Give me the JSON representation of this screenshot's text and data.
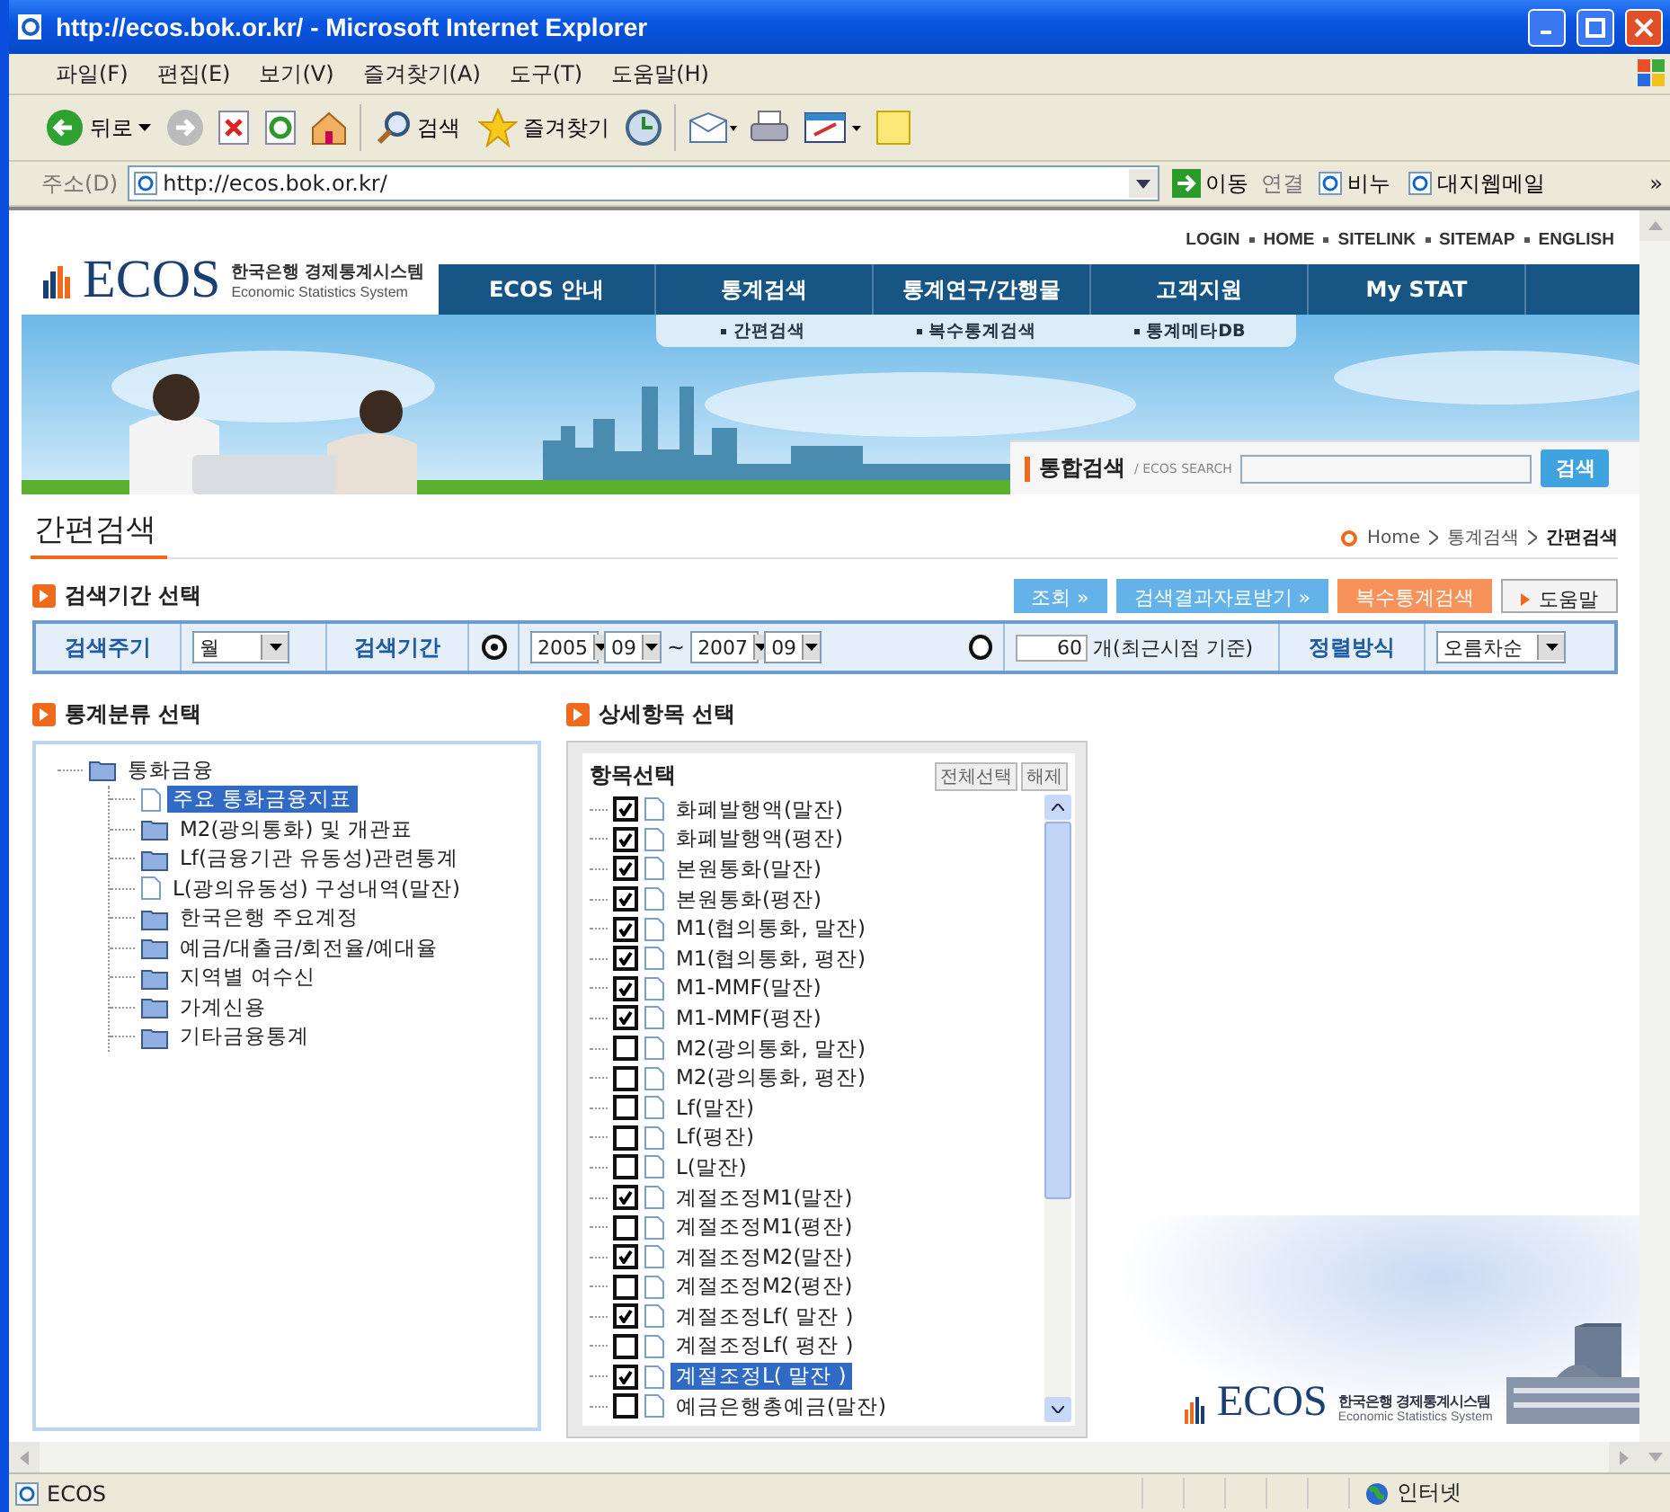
{
  "window": {
    "title": "http://ecos.bok.or.kr/ - Microsoft Internet Explorer"
  },
  "menu": [
    "파일(F)",
    "편집(E)",
    "보기(V)",
    "즐겨찾기(A)",
    "도구(T)",
    "도움말(H)"
  ],
  "toolbar": {
    "back": "뒤로",
    "search": "검색",
    "favorites": "즐겨찾기"
  },
  "address": {
    "label": "주소(D)",
    "url": "http://ecos.bok.or.kr/",
    "go": "이동",
    "links_label": "연결",
    "links": [
      "비누",
      "대지웹메일"
    ],
    "more": "»"
  },
  "site": {
    "top_links": [
      "LOGIN",
      "HOME",
      "SITELINK",
      "SITEMAP",
      "ENGLISH"
    ],
    "logo": {
      "name": "ECOS",
      "korean": "한국은행 경제통계시스템",
      "english": "Economic Statistics System"
    },
    "nav": [
      "ECOS 안내",
      "통계검색",
      "통계연구/간행물",
      "고객지원",
      "My STAT"
    ],
    "subnav": [
      "간편검색",
      "복수통계검색",
      "통계메타DB"
    ],
    "unified_search": {
      "title": "통합검색",
      "subtitle": "/ ECOS SEARCH",
      "button": "검색"
    }
  },
  "page": {
    "title": "간편검색",
    "breadcrumb": [
      "Home",
      "통계검색",
      "간편검색"
    ]
  },
  "period": {
    "title": "검색기간 선택",
    "buttons": [
      {
        "label": "조회 »",
        "kind": "blue"
      },
      {
        "label": "검색결과자료받기 »",
        "kind": "blue"
      },
      {
        "label": "복수통계검색",
        "kind": "orange"
      },
      {
        "label": "도움말",
        "kind": "plain"
      }
    ]
  },
  "filter": {
    "cycle_label": "검색주기",
    "cycle_value": "월",
    "period_label": "검색기간",
    "range": {
      "selected": true,
      "from_year": "2005",
      "from_month": "09",
      "separator": "~",
      "to_year": "2007",
      "to_month": "09"
    },
    "recent": {
      "selected": false,
      "count": "60",
      "suffix": "개(최근시점 기준)"
    },
    "sort_label": "정렬방식",
    "sort_value": "오름차순"
  },
  "tree": {
    "title": "통계분류 선택",
    "root": {
      "label": "통화금융",
      "kind": "folder",
      "selected": false,
      "children": [
        {
          "label": "주요 통화금융지표",
          "kind": "file",
          "selected": true
        },
        {
          "label": "M2(광의통화) 및 개관표",
          "kind": "folder",
          "selected": false
        },
        {
          "label": "Lf(금융기관 유동성)관련통계",
          "kind": "folder",
          "selected": false
        },
        {
          "label": "L(광의유동성) 구성내역(말잔)",
          "kind": "file",
          "selected": false
        },
        {
          "label": "한국은행 주요계정",
          "kind": "folder",
          "selected": false
        },
        {
          "label": "예금/대출금/회전율/예대율",
          "kind": "folder",
          "selected": false
        },
        {
          "label": "지역별 여수신",
          "kind": "folder",
          "selected": false
        },
        {
          "label": "가계신용",
          "kind": "folder",
          "selected": false
        },
        {
          "label": "기타금융통계",
          "kind": "folder",
          "selected": false
        }
      ]
    }
  },
  "items": {
    "title": "상세항목 선택",
    "header": "항목선택",
    "buttons": [
      "전체선택",
      "해제"
    ],
    "list": [
      {
        "label": "화폐발행액(말잔)",
        "checked": true,
        "selected": false
      },
      {
        "label": "화폐발행액(평잔)",
        "checked": true,
        "selected": false
      },
      {
        "label": "본원통화(말잔)",
        "checked": true,
        "selected": false
      },
      {
        "label": "본원통화(평잔)",
        "checked": true,
        "selected": false
      },
      {
        "label": "M1(협의통화, 말잔)",
        "checked": true,
        "selected": false
      },
      {
        "label": "M1(협의통화, 평잔)",
        "checked": true,
        "selected": false
      },
      {
        "label": "M1-MMF(말잔)",
        "checked": true,
        "selected": false
      },
      {
        "label": "M1-MMF(평잔)",
        "checked": true,
        "selected": false
      },
      {
        "label": "M2(광의통화, 말잔)",
        "checked": false,
        "selected": false
      },
      {
        "label": "M2(광의통화, 평잔)",
        "checked": false,
        "selected": false
      },
      {
        "label": "Lf(말잔)",
        "checked": false,
        "selected": false
      },
      {
        "label": "Lf(평잔)",
        "checked": false,
        "selected": false
      },
      {
        "label": "L(말잔)",
        "checked": false,
        "selected": false
      },
      {
        "label": "계절조정M1(말잔)",
        "checked": true,
        "selected": false
      },
      {
        "label": "계절조정M1(평잔)",
        "checked": false,
        "selected": false
      },
      {
        "label": "계절조정M2(말잔)",
        "checked": true,
        "selected": false
      },
      {
        "label": "계절조정M2(평잔)",
        "checked": false,
        "selected": false
      },
      {
        "label": "계절조정Lf( 말잔 )",
        "checked": true,
        "selected": false
      },
      {
        "label": "계절조정Lf( 평잔 )",
        "checked": false,
        "selected": false
      },
      {
        "label": "계절조정L( 말잔 )",
        "checked": true,
        "selected": true
      },
      {
        "label": "예금은행총예금(말잔)",
        "checked": false,
        "selected": false
      }
    ]
  },
  "footer_logo": {
    "name": "ECOS",
    "korean": "한국은행 경제통계시스템",
    "english": "Economic Statistics System"
  },
  "status_bar": {
    "text": "ECOS",
    "zone": "인터넷"
  }
}
